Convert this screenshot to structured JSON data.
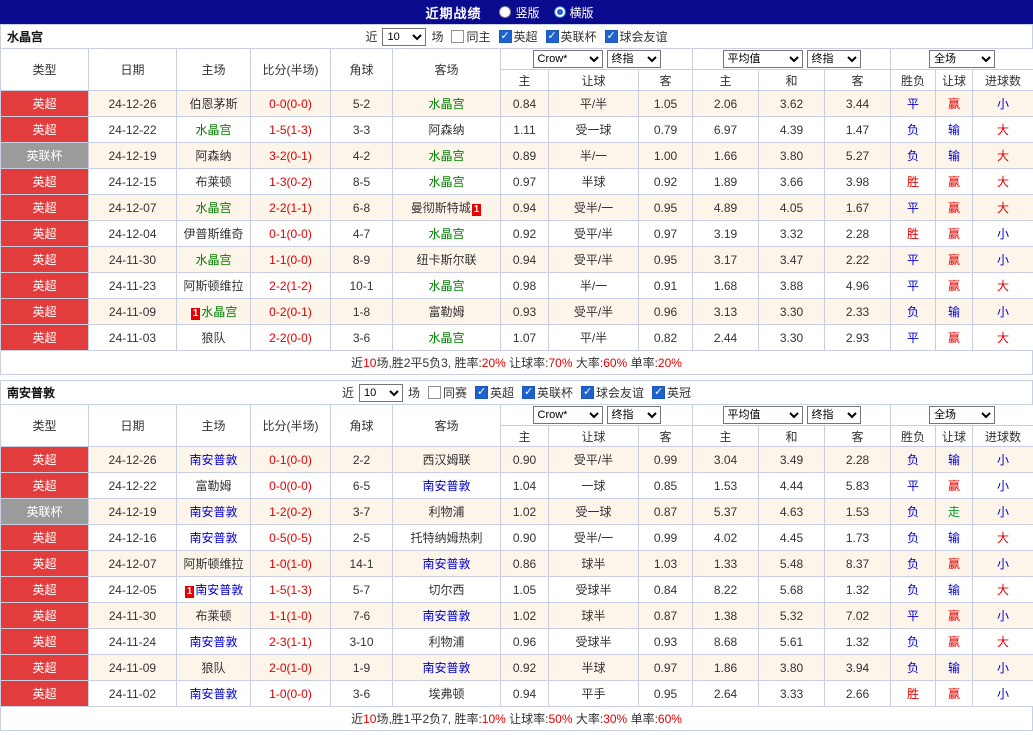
{
  "topbar": {
    "title": "近期战绩",
    "radios": [
      {
        "label": "竖版",
        "selected": false
      },
      {
        "label": "横版",
        "selected": true
      }
    ]
  },
  "league_colors": {
    "英超": "#e23c3c",
    "英联杯": "#9b9b9b"
  },
  "value_colors": {
    "胜": "#e00000",
    "平": "#0000cc",
    "负": "#0000cc",
    "赢": "#e00000",
    "输": "#0000cc",
    "走": "#009933",
    "大": "#e00000",
    "小": "#0000cc"
  },
  "header_labels": {
    "cols": [
      "类型",
      "日期",
      "主场",
      "比分(半场)",
      "角球",
      "客场"
    ],
    "sub": [
      "主",
      "让球",
      "客",
      "主",
      "和",
      "客",
      "胜负",
      "让球",
      "进球数"
    ],
    "odds_select": "Crow*",
    "odds_time_select": "终指",
    "avg_select": "平均值",
    "avg_time_select": "终指",
    "scope_select": "全场"
  },
  "sections": [
    {
      "team": "水晶宫",
      "team_color": "#008000",
      "filter": {
        "near": "近",
        "rounds": "10",
        "unit": "场",
        "checkboxes": [
          {
            "label": "同主",
            "checked": false
          },
          {
            "label": "英超",
            "checked": true
          },
          {
            "label": "英联杯",
            "checked": true
          },
          {
            "label": "球会友谊",
            "checked": true
          }
        ]
      },
      "rows": [
        {
          "league": "英超",
          "date": "24-12-26",
          "home": "伯恩茅斯",
          "score": "0-0(0-0)",
          "corner": "5-2",
          "away": "水晶宫",
          "away_hl": true,
          "odds": [
            "0.84",
            "平/半",
            "1.05"
          ],
          "avg": [
            "2.06",
            "3.62",
            "3.44"
          ],
          "result": "平",
          "handicap": "赢",
          "goals": "小"
        },
        {
          "league": "英超",
          "date": "24-12-22",
          "home": "水晶宫",
          "home_hl": true,
          "score": "1-5(1-3)",
          "corner": "3-3",
          "away": "阿森纳",
          "odds": [
            "1.11",
            "受一球",
            "0.79"
          ],
          "avg": [
            "6.97",
            "4.39",
            "1.47"
          ],
          "result": "负",
          "handicap": "输",
          "goals": "大"
        },
        {
          "league": "英联杯",
          "date": "24-12-19",
          "home": "阿森纳",
          "score": "3-2(0-1)",
          "corner": "4-2",
          "away": "水晶宫",
          "away_hl": true,
          "odds": [
            "0.89",
            "半/一",
            "1.00"
          ],
          "avg": [
            "1.66",
            "3.80",
            "5.27"
          ],
          "result": "负",
          "handicap": "输",
          "goals": "大"
        },
        {
          "league": "英超",
          "date": "24-12-15",
          "home": "布莱顿",
          "score": "1-3(0-2)",
          "corner": "8-5",
          "away": "水晶宫",
          "away_hl": true,
          "odds": [
            "0.97",
            "半球",
            "0.92"
          ],
          "avg": [
            "1.89",
            "3.66",
            "3.98"
          ],
          "result": "胜",
          "handicap": "赢",
          "goals": "大"
        },
        {
          "league": "英超",
          "date": "24-12-07",
          "home": "水晶宫",
          "home_hl": true,
          "score": "2-2(1-1)",
          "corner": "6-8",
          "away": "曼彻斯特城",
          "away_badge_after": "1",
          "odds": [
            "0.94",
            "受半/一",
            "0.95"
          ],
          "avg": [
            "4.89",
            "4.05",
            "1.67"
          ],
          "result": "平",
          "handicap": "赢",
          "goals": "大"
        },
        {
          "league": "英超",
          "date": "24-12-04",
          "home": "伊普斯维奇",
          "score": "0-1(0-0)",
          "corner": "4-7",
          "away": "水晶宫",
          "away_hl": true,
          "odds": [
            "0.92",
            "受平/半",
            "0.97"
          ],
          "avg": [
            "3.19",
            "3.32",
            "2.28"
          ],
          "result": "胜",
          "handicap": "赢",
          "goals": "小"
        },
        {
          "league": "英超",
          "date": "24-11-30",
          "home": "水晶宫",
          "home_hl": true,
          "score": "1-1(0-0)",
          "corner": "8-9",
          "away": "纽卡斯尔联",
          "odds": [
            "0.94",
            "受平/半",
            "0.95"
          ],
          "avg": [
            "3.17",
            "3.47",
            "2.22"
          ],
          "result": "平",
          "handicap": "赢",
          "goals": "小"
        },
        {
          "league": "英超",
          "date": "24-11-23",
          "home": "阿斯顿维拉",
          "score": "2-2(1-2)",
          "corner": "10-1",
          "away": "水晶宫",
          "away_hl": true,
          "odds": [
            "0.98",
            "半/一",
            "0.91"
          ],
          "avg": [
            "1.68",
            "3.88",
            "4.96"
          ],
          "result": "平",
          "handicap": "赢",
          "goals": "大"
        },
        {
          "league": "英超",
          "date": "24-11-09",
          "home": "水晶宫",
          "home_hl": true,
          "home_badge_before": "1",
          "score": "0-2(0-1)",
          "corner": "1-8",
          "away": "富勒姆",
          "odds": [
            "0.93",
            "受平/半",
            "0.96"
          ],
          "avg": [
            "3.13",
            "3.30",
            "2.33"
          ],
          "result": "负",
          "handicap": "输",
          "goals": "小"
        },
        {
          "league": "英超",
          "date": "24-11-03",
          "home": "狼队",
          "score": "2-2(0-0)",
          "corner": "3-6",
          "away": "水晶宫",
          "away_hl": true,
          "odds": [
            "1.07",
            "平/半",
            "0.82"
          ],
          "avg": [
            "2.44",
            "3.30",
            "2.93"
          ],
          "result": "平",
          "handicap": "赢",
          "goals": "大"
        }
      ],
      "summary": {
        "segments": [
          {
            "text": "近"
          },
          {
            "text": "10",
            "red": true
          },
          {
            "text": "场,胜2平5负3, 胜率:"
          },
          {
            "text": "20%",
            "red": true
          },
          {
            "text": " 让球率:"
          },
          {
            "text": "70%",
            "red": true
          },
          {
            "text": " 大率:"
          },
          {
            "text": "60%",
            "red": true
          },
          {
            "text": " 单率:"
          },
          {
            "text": "20%",
            "red": true
          }
        ]
      }
    },
    {
      "team": "南安普敦",
      "team_color": "#0000cc",
      "filter": {
        "near": "近",
        "rounds": "10",
        "unit": "场",
        "checkboxes": [
          {
            "label": "同赛",
            "checked": false
          },
          {
            "label": "英超",
            "checked": true
          },
          {
            "label": "英联杯",
            "checked": true
          },
          {
            "label": "球会友谊",
            "checked": true
          },
          {
            "label": "英冠",
            "checked": true
          }
        ]
      },
      "rows": [
        {
          "league": "英超",
          "date": "24-12-26",
          "home": "南安普敦",
          "home_hl": true,
          "score": "0-1(0-0)",
          "corner": "2-2",
          "away": "西汉姆联",
          "odds": [
            "0.90",
            "受平/半",
            "0.99"
          ],
          "avg": [
            "3.04",
            "3.49",
            "2.28"
          ],
          "result": "负",
          "handicap": "输",
          "goals": "小"
        },
        {
          "league": "英超",
          "date": "24-12-22",
          "home": "富勒姆",
          "score": "0-0(0-0)",
          "corner": "6-5",
          "away": "南安普敦",
          "away_hl": true,
          "odds": [
            "1.04",
            "一球",
            "0.85"
          ],
          "avg": [
            "1.53",
            "4.44",
            "5.83"
          ],
          "result": "平",
          "handicap": "赢",
          "goals": "小"
        },
        {
          "league": "英联杯",
          "date": "24-12-19",
          "home": "南安普敦",
          "home_hl": true,
          "score": "1-2(0-2)",
          "corner": "3-7",
          "away": "利物浦",
          "odds": [
            "1.02",
            "受一球",
            "0.87"
          ],
          "avg": [
            "5.37",
            "4.63",
            "1.53"
          ],
          "result": "负",
          "handicap": "走",
          "goals": "小"
        },
        {
          "league": "英超",
          "date": "24-12-16",
          "home": "南安普敦",
          "home_hl": true,
          "score": "0-5(0-5)",
          "corner": "2-5",
          "away": "托特纳姆热刺",
          "odds": [
            "0.90",
            "受半/一",
            "0.99"
          ],
          "avg": [
            "4.02",
            "4.45",
            "1.73"
          ],
          "result": "负",
          "handicap": "输",
          "goals": "大"
        },
        {
          "league": "英超",
          "date": "24-12-07",
          "home": "阿斯顿维拉",
          "score": "1-0(1-0)",
          "corner": "14-1",
          "away": "南安普敦",
          "away_hl": true,
          "odds": [
            "0.86",
            "球半",
            "1.03"
          ],
          "avg": [
            "1.33",
            "5.48",
            "8.37"
          ],
          "result": "负",
          "handicap": "赢",
          "goals": "小"
        },
        {
          "league": "英超",
          "date": "24-12-05",
          "home": "南安普敦",
          "home_hl": true,
          "home_badge_before": "1",
          "score": "1-5(1-3)",
          "corner": "5-7",
          "away": "切尔西",
          "odds": [
            "1.05",
            "受球半",
            "0.84"
          ],
          "avg": [
            "8.22",
            "5.68",
            "1.32"
          ],
          "result": "负",
          "handicap": "输",
          "goals": "大"
        },
        {
          "league": "英超",
          "date": "24-11-30",
          "home": "布莱顿",
          "score": "1-1(1-0)",
          "corner": "7-6",
          "away": "南安普敦",
          "away_hl": true,
          "odds": [
            "1.02",
            "球半",
            "0.87"
          ],
          "avg": [
            "1.38",
            "5.32",
            "7.02"
          ],
          "result": "平",
          "handicap": "赢",
          "goals": "小"
        },
        {
          "league": "英超",
          "date": "24-11-24",
          "home": "南安普敦",
          "home_hl": true,
          "score": "2-3(1-1)",
          "corner": "3-10",
          "away": "利物浦",
          "odds": [
            "0.96",
            "受球半",
            "0.93"
          ],
          "avg": [
            "8.68",
            "5.61",
            "1.32"
          ],
          "result": "负",
          "handicap": "赢",
          "goals": "大"
        },
        {
          "league": "英超",
          "date": "24-11-09",
          "home": "狼队",
          "score": "2-0(1-0)",
          "corner": "1-9",
          "away": "南安普敦",
          "away_hl": true,
          "odds": [
            "0.92",
            "半球",
            "0.97"
          ],
          "avg": [
            "1.86",
            "3.80",
            "3.94"
          ],
          "result": "负",
          "handicap": "输",
          "goals": "小"
        },
        {
          "league": "英超",
          "date": "24-11-02",
          "home": "南安普敦",
          "home_hl": true,
          "score": "1-0(0-0)",
          "corner": "3-6",
          "away": "埃弗顿",
          "odds": [
            "0.94",
            "平手",
            "0.95"
          ],
          "avg": [
            "2.64",
            "3.33",
            "2.66"
          ],
          "result": "胜",
          "handicap": "赢",
          "goals": "小"
        }
      ],
      "summary": {
        "segments": [
          {
            "text": "近"
          },
          {
            "text": "10",
            "red": true
          },
          {
            "text": "场,胜1平2负7, 胜率:"
          },
          {
            "text": "10%",
            "red": true
          },
          {
            "text": " 让球率:"
          },
          {
            "text": "50%",
            "red": true
          },
          {
            "text": " 大率:"
          },
          {
            "text": "30%",
            "red": true
          },
          {
            "text": " 单率:"
          },
          {
            "text": "60%",
            "red": true
          }
        ]
      }
    }
  ]
}
